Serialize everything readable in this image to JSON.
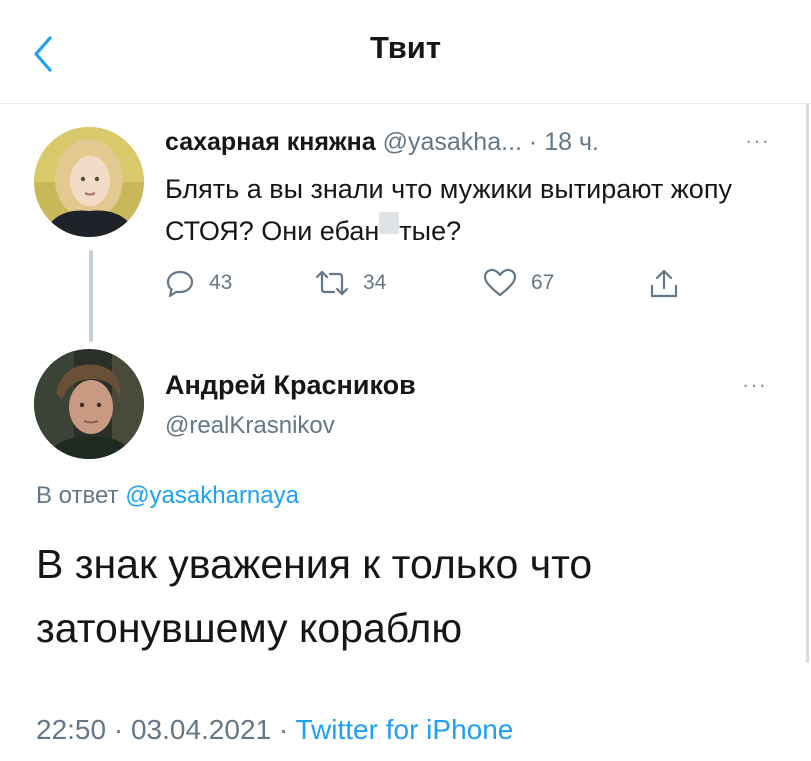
{
  "header": {
    "title": "Твит",
    "back_icon": "chevron-left-icon"
  },
  "tweet1": {
    "name": "сахарная княжна",
    "handle": "@yasakha...",
    "separator": "·",
    "time": "18 ч.",
    "more": "···",
    "text_before": "Блять а вы знали что мужики вытирают жопу СТОЯ? Они ебан",
    "text_after": "тые?",
    "actions": {
      "replies": "43",
      "retweets": "34",
      "likes": "67"
    }
  },
  "tweet2": {
    "name": "Андрей Красников",
    "handle": "@realKrasnikov",
    "more": "···",
    "reply_prefix": "В ответ",
    "reply_handle": "@yasakharnaya",
    "text": "В знак уважения к только что затонувшему кораблю",
    "timestamp": "22:50 · 03.04.2021 ·",
    "source": "Twitter for iPhone"
  },
  "colors": {
    "accent": "#1da1f2",
    "secondary_text": "#657786",
    "icon": "#657786"
  }
}
